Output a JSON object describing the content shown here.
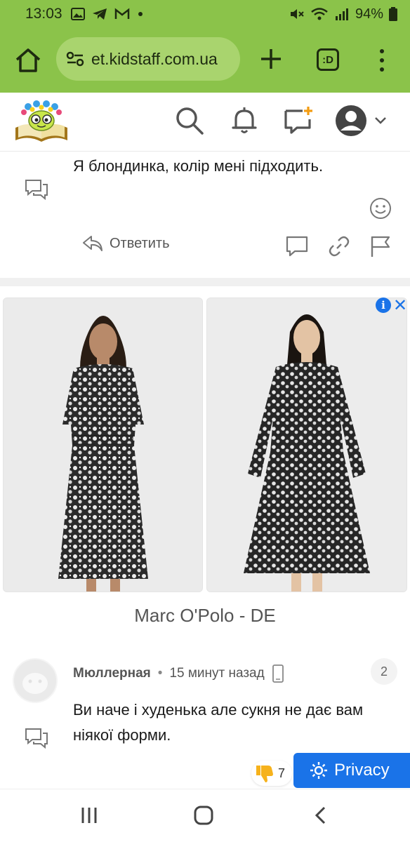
{
  "status_bar": {
    "time": "13:03",
    "battery": "94%",
    "left_icons": [
      "image-icon",
      "telegram-icon",
      "gmail-icon",
      "dot-icon"
    ],
    "right_icons": [
      "mute-icon",
      "wifi-icon",
      "signal-icon",
      "battery-icon"
    ]
  },
  "browser": {
    "url": "et.kidstaff.com.ua",
    "tab_label": ":D"
  },
  "post": {
    "text": "Я блондинка, колір мені підходить.",
    "answer_label": "Ответить"
  },
  "ad": {
    "caption": "Marc O'Polo - DE",
    "colors": {
      "accent": "#1a73e8"
    }
  },
  "comment": {
    "author": "Мюллерная",
    "separator": "•",
    "time": "15 минут назад",
    "reply_count": "2",
    "text": "Ви наче і худенька але сукня не дає вам ніякої форми.",
    "rating": "7"
  },
  "privacy": {
    "label": "Privacy"
  },
  "colors": {
    "browser_bar": "#8bc34a",
    "accent": "#1a73e8"
  }
}
